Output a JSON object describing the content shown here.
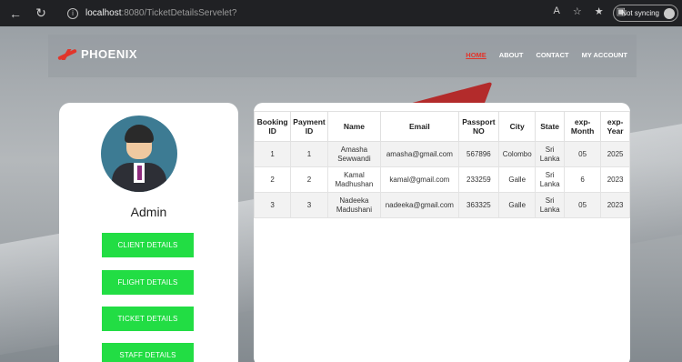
{
  "browser": {
    "host": "localhost",
    "path": ":8080/TicketDetailsServelet?",
    "sync_label": "Not syncing"
  },
  "site": {
    "brand": "PHOENIX",
    "nav": [
      "HOME",
      "ABOUT",
      "CONTACT",
      "MY ACCOUNT"
    ],
    "active_nav": "HOME"
  },
  "sidebar": {
    "user_name": "Admin",
    "buttons": [
      "CLIENT DETAILS",
      "FLIGHT DETAILS",
      "TICKET DETAILS",
      "STAFF DETAILS"
    ]
  },
  "table": {
    "headers": [
      [
        "Booking",
        "ID"
      ],
      [
        "Payment",
        "ID"
      ],
      [
        "Name"
      ],
      [
        "Email"
      ],
      [
        "Passport",
        "NO"
      ],
      [
        "City"
      ],
      [
        "State"
      ],
      [
        "exp-",
        "Month"
      ],
      [
        "exp-",
        "Year"
      ]
    ],
    "rows": [
      [
        "1",
        "1",
        "Amasha Sewwandi",
        "amasha@gmail.com",
        "567896",
        "Colombo",
        "Sri Lanka",
        "05",
        "2025"
      ],
      [
        "2",
        "2",
        "Kamal Madhushan",
        "kamal@gmail.com",
        "233259",
        "Galle",
        "Sri Lanka",
        "6",
        "2023"
      ],
      [
        "3",
        "3",
        "Nadeeka Madushani",
        "nadeeka@gmail.com",
        "363325",
        "Galle",
        "Sri Lanka",
        "05",
        "2023"
      ]
    ]
  },
  "colors": {
    "accent_green": "#22dd44",
    "brand_red": "#e2352b"
  }
}
